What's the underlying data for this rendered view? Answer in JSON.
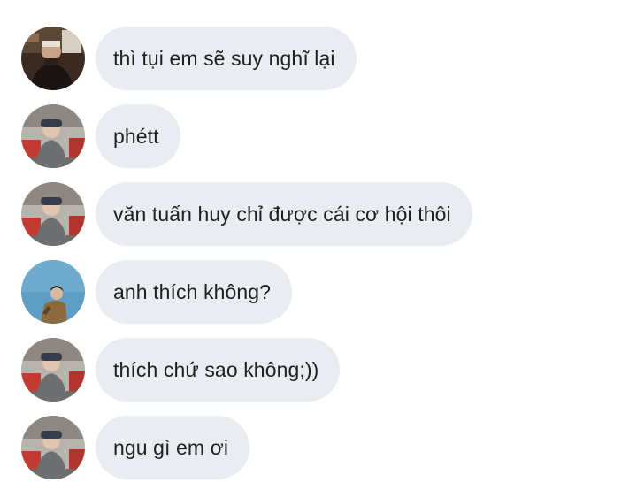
{
  "conversation": {
    "messages": [
      {
        "avatar": "avatar-man-dark-room",
        "text": "thì tụi em sẽ suy nghĩ lại"
      },
      {
        "avatar": "avatar-boy-beanie-street",
        "text": "phétt"
      },
      {
        "avatar": "avatar-boy-beanie-street",
        "text": "văn tuấn huy chỉ được cái cơ hội thôi"
      },
      {
        "avatar": "avatar-person-blue-sky",
        "text": "anh thích không?"
      },
      {
        "avatar": "avatar-boy-beanie-street",
        "text": "thích chứ sao không;))"
      },
      {
        "avatar": "avatar-boy-beanie-street",
        "text": "ngu gì em ơi"
      }
    ]
  },
  "colors": {
    "bubble": "#e9ecf0",
    "text": "#1f1f1f",
    "background": "#ffffff"
  }
}
